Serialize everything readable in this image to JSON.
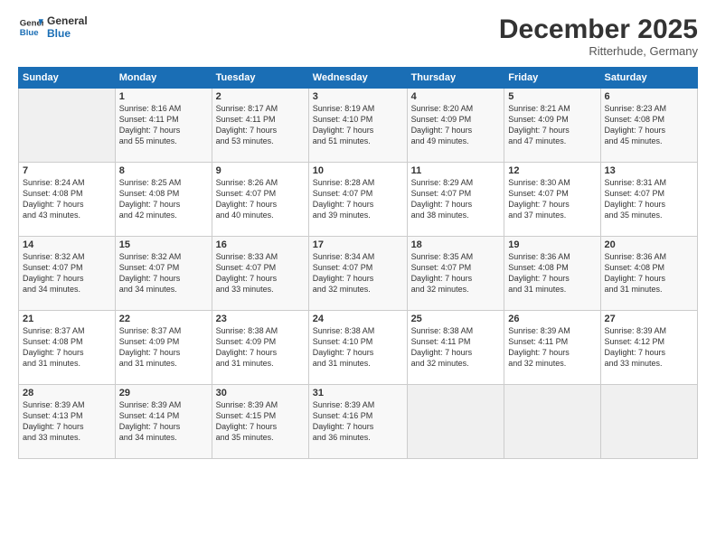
{
  "header": {
    "logo_line1": "General",
    "logo_line2": "Blue",
    "month": "December 2025",
    "location": "Ritterhude, Germany"
  },
  "weekdays": [
    "Sunday",
    "Monday",
    "Tuesday",
    "Wednesday",
    "Thursday",
    "Friday",
    "Saturday"
  ],
  "weeks": [
    [
      {
        "day": "",
        "info": ""
      },
      {
        "day": "1",
        "info": "Sunrise: 8:16 AM\nSunset: 4:11 PM\nDaylight: 7 hours\nand 55 minutes."
      },
      {
        "day": "2",
        "info": "Sunrise: 8:17 AM\nSunset: 4:11 PM\nDaylight: 7 hours\nand 53 minutes."
      },
      {
        "day": "3",
        "info": "Sunrise: 8:19 AM\nSunset: 4:10 PM\nDaylight: 7 hours\nand 51 minutes."
      },
      {
        "day": "4",
        "info": "Sunrise: 8:20 AM\nSunset: 4:09 PM\nDaylight: 7 hours\nand 49 minutes."
      },
      {
        "day": "5",
        "info": "Sunrise: 8:21 AM\nSunset: 4:09 PM\nDaylight: 7 hours\nand 47 minutes."
      },
      {
        "day": "6",
        "info": "Sunrise: 8:23 AM\nSunset: 4:08 PM\nDaylight: 7 hours\nand 45 minutes."
      }
    ],
    [
      {
        "day": "7",
        "info": "Sunrise: 8:24 AM\nSunset: 4:08 PM\nDaylight: 7 hours\nand 43 minutes."
      },
      {
        "day": "8",
        "info": "Sunrise: 8:25 AM\nSunset: 4:08 PM\nDaylight: 7 hours\nand 42 minutes."
      },
      {
        "day": "9",
        "info": "Sunrise: 8:26 AM\nSunset: 4:07 PM\nDaylight: 7 hours\nand 40 minutes."
      },
      {
        "day": "10",
        "info": "Sunrise: 8:28 AM\nSunset: 4:07 PM\nDaylight: 7 hours\nand 39 minutes."
      },
      {
        "day": "11",
        "info": "Sunrise: 8:29 AM\nSunset: 4:07 PM\nDaylight: 7 hours\nand 38 minutes."
      },
      {
        "day": "12",
        "info": "Sunrise: 8:30 AM\nSunset: 4:07 PM\nDaylight: 7 hours\nand 37 minutes."
      },
      {
        "day": "13",
        "info": "Sunrise: 8:31 AM\nSunset: 4:07 PM\nDaylight: 7 hours\nand 35 minutes."
      }
    ],
    [
      {
        "day": "14",
        "info": "Sunrise: 8:32 AM\nSunset: 4:07 PM\nDaylight: 7 hours\nand 34 minutes."
      },
      {
        "day": "15",
        "info": "Sunrise: 8:32 AM\nSunset: 4:07 PM\nDaylight: 7 hours\nand 34 minutes."
      },
      {
        "day": "16",
        "info": "Sunrise: 8:33 AM\nSunset: 4:07 PM\nDaylight: 7 hours\nand 33 minutes."
      },
      {
        "day": "17",
        "info": "Sunrise: 8:34 AM\nSunset: 4:07 PM\nDaylight: 7 hours\nand 32 minutes."
      },
      {
        "day": "18",
        "info": "Sunrise: 8:35 AM\nSunset: 4:07 PM\nDaylight: 7 hours\nand 32 minutes."
      },
      {
        "day": "19",
        "info": "Sunrise: 8:36 AM\nSunset: 4:08 PM\nDaylight: 7 hours\nand 31 minutes."
      },
      {
        "day": "20",
        "info": "Sunrise: 8:36 AM\nSunset: 4:08 PM\nDaylight: 7 hours\nand 31 minutes."
      }
    ],
    [
      {
        "day": "21",
        "info": "Sunrise: 8:37 AM\nSunset: 4:08 PM\nDaylight: 7 hours\nand 31 minutes."
      },
      {
        "day": "22",
        "info": "Sunrise: 8:37 AM\nSunset: 4:09 PM\nDaylight: 7 hours\nand 31 minutes."
      },
      {
        "day": "23",
        "info": "Sunrise: 8:38 AM\nSunset: 4:09 PM\nDaylight: 7 hours\nand 31 minutes."
      },
      {
        "day": "24",
        "info": "Sunrise: 8:38 AM\nSunset: 4:10 PM\nDaylight: 7 hours\nand 31 minutes."
      },
      {
        "day": "25",
        "info": "Sunrise: 8:38 AM\nSunset: 4:11 PM\nDaylight: 7 hours\nand 32 minutes."
      },
      {
        "day": "26",
        "info": "Sunrise: 8:39 AM\nSunset: 4:11 PM\nDaylight: 7 hours\nand 32 minutes."
      },
      {
        "day": "27",
        "info": "Sunrise: 8:39 AM\nSunset: 4:12 PM\nDaylight: 7 hours\nand 33 minutes."
      }
    ],
    [
      {
        "day": "28",
        "info": "Sunrise: 8:39 AM\nSunset: 4:13 PM\nDaylight: 7 hours\nand 33 minutes."
      },
      {
        "day": "29",
        "info": "Sunrise: 8:39 AM\nSunset: 4:14 PM\nDaylight: 7 hours\nand 34 minutes."
      },
      {
        "day": "30",
        "info": "Sunrise: 8:39 AM\nSunset: 4:15 PM\nDaylight: 7 hours\nand 35 minutes."
      },
      {
        "day": "31",
        "info": "Sunrise: 8:39 AM\nSunset: 4:16 PM\nDaylight: 7 hours\nand 36 minutes."
      },
      {
        "day": "",
        "info": ""
      },
      {
        "day": "",
        "info": ""
      },
      {
        "day": "",
        "info": ""
      }
    ]
  ]
}
